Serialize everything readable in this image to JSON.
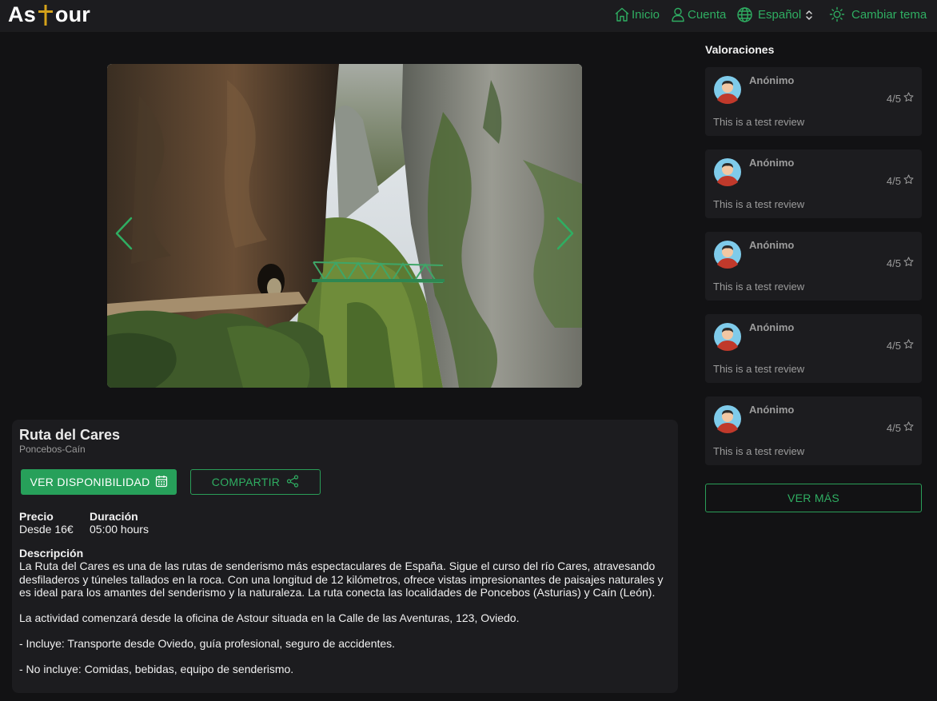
{
  "header": {
    "logo_text_pre": "As",
    "logo_text_post": "our",
    "nav": {
      "home": "Inicio",
      "account": "Cuenta",
      "language": "Español",
      "theme": "Cambiar tema"
    },
    "icons": [
      "home-icon",
      "user-icon",
      "globe-icon",
      "chevron-updown-icon",
      "sun-icon"
    ]
  },
  "carousel": {
    "prev_icon": "chevron-left-icon",
    "next_icon": "chevron-right-icon"
  },
  "tour": {
    "title": "Ruta del Cares",
    "subtitle": "Poncebos-Caín",
    "availability_button": "VER DISPONIBILIDAD",
    "share_button": "COMPARTIR",
    "price_label": "Precio",
    "price_value": "Desde 16€",
    "duration_label": "Duración",
    "duration_value": "05:00 hours",
    "description_label": "Descripción",
    "description": [
      "La Ruta del Cares es una de las rutas de senderismo más espectaculares de España. Sigue el curso del río Cares, atravesando desfiladeros y túneles tallados en la roca. Con una longitud de 12 kilómetros, ofrece vistas impresionantes de paisajes naturales y es ideal para los amantes del senderismo y la naturaleza. La ruta conecta las localidades de Poncebos (Asturias) y Caín (León).",
      "La actividad comenzará desde la oficina de Astour situada en la Calle de las Aventuras, 123, Oviedo.",
      "- Incluye: Transporte desde Oviedo, guía profesional, seguro de accidentes.",
      "- No incluye: Comidas, bebidas, equipo de senderismo."
    ]
  },
  "reviews": {
    "title": "Valoraciones",
    "items": [
      {
        "author": "Anónimo",
        "rating": "4/5",
        "text": "This is a test review"
      },
      {
        "author": "Anónimo",
        "rating": "4/5",
        "text": "This is a test review"
      },
      {
        "author": "Anónimo",
        "rating": "4/5",
        "text": "This is a test review"
      },
      {
        "author": "Anónimo",
        "rating": "4/5",
        "text": "This is a test review"
      },
      {
        "author": "Anónimo",
        "rating": "4/5",
        "text": "This is a test review"
      }
    ],
    "more_button": "VER MÁS"
  },
  "colors": {
    "accent": "#2fae62",
    "accent_button": "#27a05a",
    "background": "#121214",
    "surface": "#1c1c1f",
    "logo_cross": "#d4a21a"
  }
}
